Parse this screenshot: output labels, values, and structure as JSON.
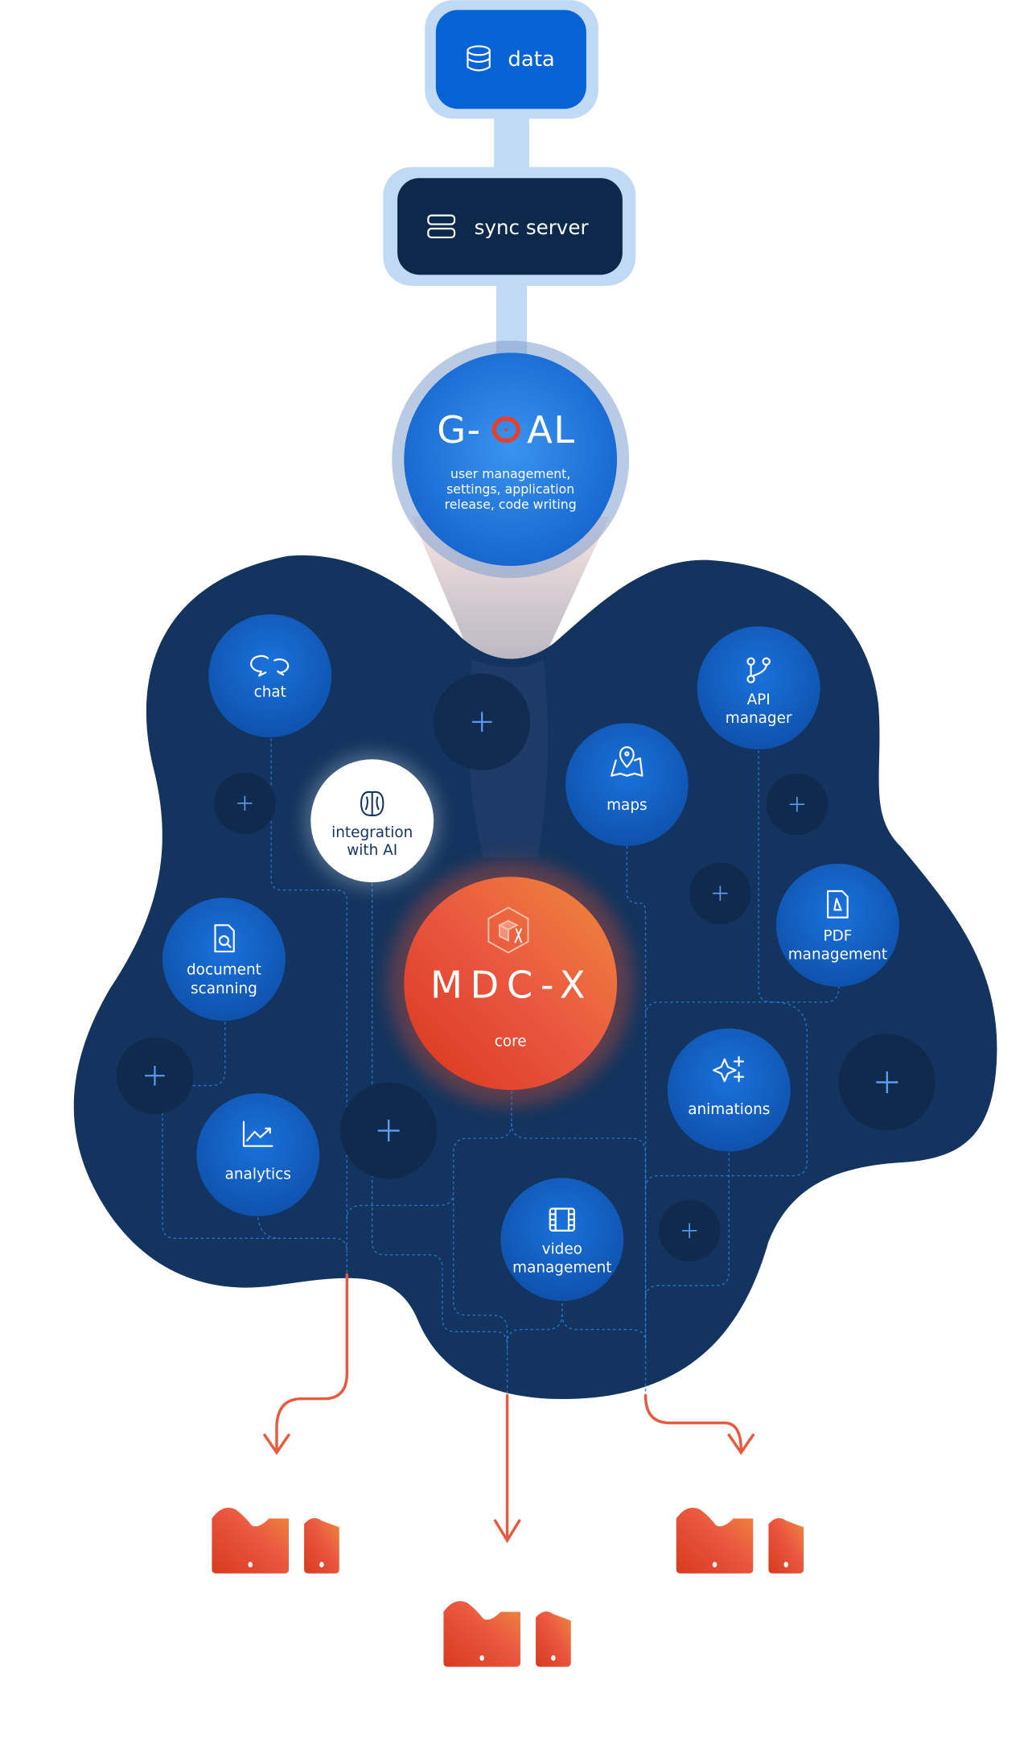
{
  "colors": {
    "blob": "#12345e",
    "node_blue": "#1466d0",
    "data_box": "#0563d6",
    "server_box": "#0c284a",
    "connector": "#c0d9f4",
    "core_orange": "#e9512f",
    "arrow": "#e85a3f",
    "white_node": "#ffffff"
  },
  "top": {
    "data_label": "data",
    "data_icon": "database-icon",
    "server_label": "sync server",
    "server_icon": "server-icon"
  },
  "goal": {
    "logo": "G-OAL",
    "description": [
      "user management,",
      "settings, application",
      "release, code writing"
    ]
  },
  "core": {
    "logo": "MDC-X",
    "label": "core",
    "icon": "cube-hexagon-icon"
  },
  "modules": [
    {
      "id": "chat",
      "lines": [
        "chat"
      ],
      "icon": "chat-icon"
    },
    {
      "id": "api-manager",
      "lines": [
        "API",
        "manager"
      ],
      "icon": "git-branch-icon"
    },
    {
      "id": "integration-ai",
      "lines": [
        "integration",
        "with AI"
      ],
      "icon": "brain-icon"
    },
    {
      "id": "maps",
      "lines": [
        "maps"
      ],
      "icon": "map-pin-icon"
    },
    {
      "id": "document-scanning",
      "lines": [
        "document",
        "scanning"
      ],
      "icon": "document-search-icon"
    },
    {
      "id": "pdf-management",
      "lines": [
        "PDF",
        "management"
      ],
      "icon": "pdf-file-icon"
    },
    {
      "id": "animations",
      "lines": [
        "animations"
      ],
      "icon": "sparkles-icon"
    },
    {
      "id": "analytics",
      "lines": [
        "analytics"
      ],
      "icon": "chart-line-icon"
    },
    {
      "id": "video-management",
      "lines": [
        "video",
        "management"
      ],
      "icon": "film-icon"
    }
  ],
  "add_buttons": 8,
  "outputs": [
    "device-group-left",
    "device-group-center",
    "device-group-right"
  ]
}
